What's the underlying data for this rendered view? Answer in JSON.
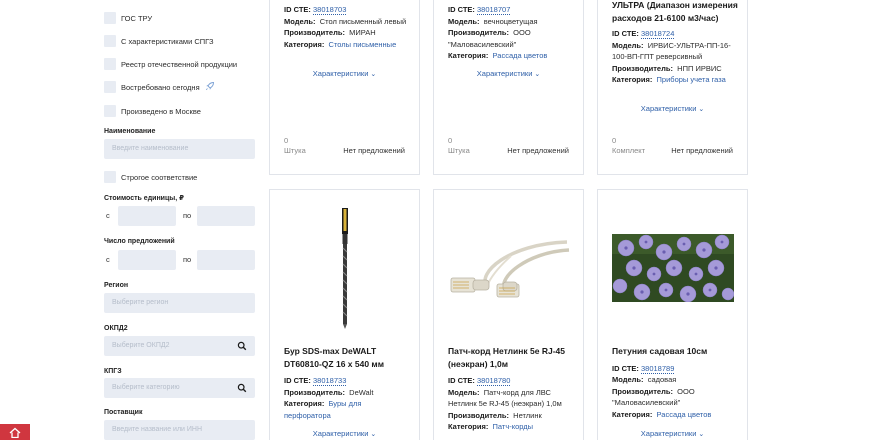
{
  "filters": {
    "checkboxes": [
      {
        "label": "ГОС ТРУ"
      },
      {
        "label": "С характеристиками СПГЗ"
      },
      {
        "label": "Реестр отечественной продукции"
      },
      {
        "label": "Востребовано сегодня"
      },
      {
        "label": "Произведено в Москве"
      }
    ],
    "name_label": "Наименование",
    "name_placeholder": "Введите наименование",
    "strict_label": "Строгое соответствие",
    "price_label": "Стоимость единицы, ₽",
    "from_label": "с",
    "to_label": "по",
    "offers_label": "Число предложений",
    "region_label": "Регион",
    "region_placeholder": "Выберите регион",
    "okpd_label": "ОКПД2",
    "okpd_placeholder": "Выберите ОКПД2",
    "kpgz_label": "КПГЗ",
    "kpgz_placeholder": "Выберите категорию",
    "supplier_label": "Поставщик",
    "supplier_placeholder": "Введите название или ИНН"
  },
  "labels": {
    "id": "ID СТЕ:",
    "model": "Модель:",
    "maker": "Производитель:",
    "category": "Категория:",
    "characteristics": "Характеристики",
    "no_offers": "Нет предложений"
  },
  "cards_top": [
    {
      "id": "38018703",
      "model": "Стол письменный левый",
      "maker": "МИРАН",
      "category": "Столы письменные",
      "qty": "0",
      "unit": "Штука"
    },
    {
      "id": "38018707",
      "model": "вечноцветущая",
      "maker": "ООО \"Маловасилевский\"",
      "category": "Рассада цветов",
      "qty": "0",
      "unit": "Штука"
    },
    {
      "title": "УЛЬТРА (Диапазон измерения расходов 21-6100 м3/час)",
      "id": "38018724",
      "model": "ИРВИС-УЛЬТРА-ПП-16-100-ВП-ГПТ реверсивный",
      "maker": "НПП ИРВИС",
      "category": "Приборы учета газа",
      "qty": "0",
      "unit": "Комплект"
    }
  ],
  "cards_bottom": [
    {
      "title": "Бур SDS-max DeWALT DT60810-QZ 16 x 540 мм",
      "id": "38018733",
      "maker": "DeWalt",
      "category": "Буры для перфоратора",
      "image": "drill-bit"
    },
    {
      "title": "Патч-корд Нетлинк 5е RJ-45 (неэкран) 1,0м",
      "id": "38018780",
      "model": "Патч-корд для ЛВС Нетлинк 5е RJ-45 (неэкран) 1,0м",
      "maker": "Нетлинк",
      "category": "Патч-корды",
      "image": "patch-cord"
    },
    {
      "title": "Петуния садовая 10см",
      "id": "38018789",
      "model": "садовая",
      "maker": "ООО \"Маловасилевский\"",
      "category": "Рассада цветов",
      "image": "petunia-flowers"
    }
  ],
  "colors": {
    "link": "#2e5fa8",
    "input_bg": "#e8ecf3",
    "brand_red": "#d0363f"
  }
}
